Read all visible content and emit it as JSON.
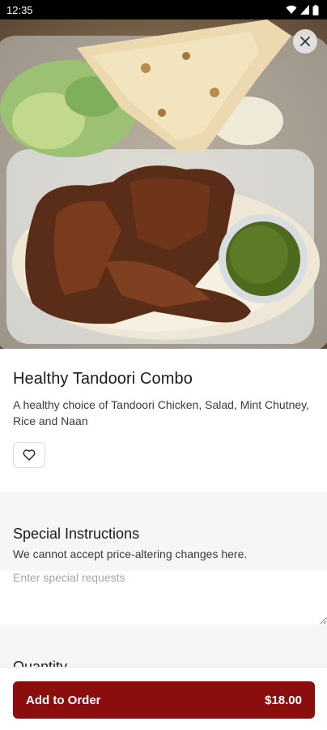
{
  "status_bar": {
    "time": "12:35"
  },
  "item": {
    "title": "Healthy Tandoori Combo",
    "description": "A healthy choice of Tandoori Chicken, Salad, Mint Chutney, Rice and Naan"
  },
  "special_instructions": {
    "title": "Special Instructions",
    "subtitle": "We cannot accept price-altering changes here.",
    "placeholder": "Enter special requests"
  },
  "quantity": {
    "title": "Quantity"
  },
  "order_button": {
    "label": "Add to Order",
    "price": "$18.00"
  },
  "colors": {
    "accent": "#8b0e0e",
    "section_bg": "#f6f6f6"
  }
}
